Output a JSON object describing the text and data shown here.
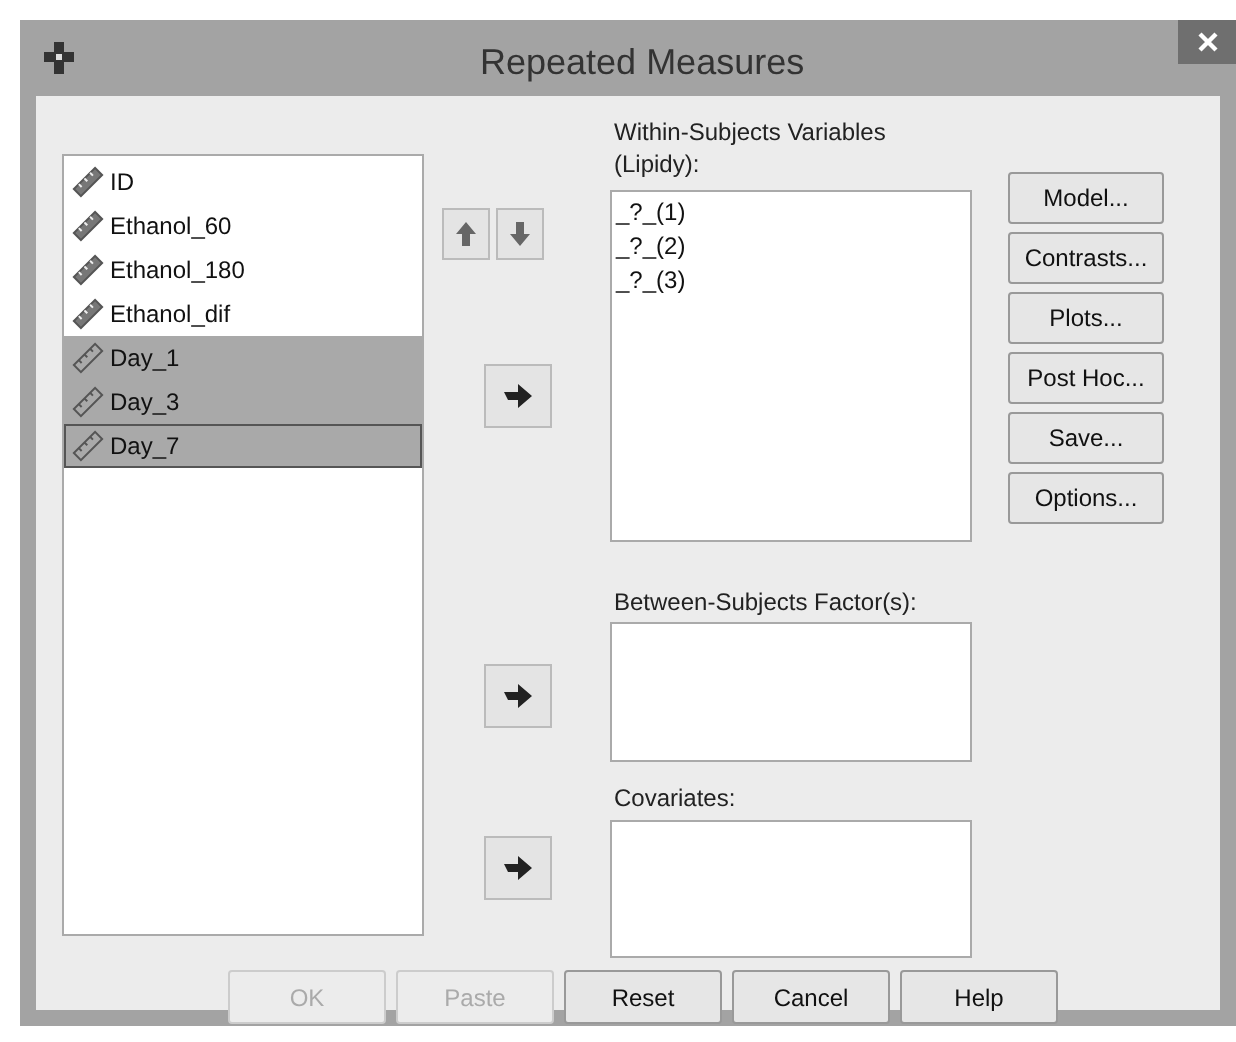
{
  "window": {
    "title": "Repeated Measures"
  },
  "variables": [
    {
      "name": "ID",
      "selected": false,
      "focused": false
    },
    {
      "name": "Ethanol_60",
      "selected": false,
      "focused": false
    },
    {
      "name": "Ethanol_180",
      "selected": false,
      "focused": false
    },
    {
      "name": "Ethanol_dif",
      "selected": false,
      "focused": false
    },
    {
      "name": "Day_1",
      "selected": true,
      "focused": false
    },
    {
      "name": "Day_3",
      "selected": true,
      "focused": false
    },
    {
      "name": "Day_7",
      "selected": true,
      "focused": true
    }
  ],
  "within_subjects": {
    "label": "Within-Subjects Variables (Lipidy):",
    "items": [
      "_?_(1)",
      "_?_(2)",
      "_?_(3)"
    ]
  },
  "between_subjects": {
    "label": "Between-Subjects Factor(s):"
  },
  "covariates": {
    "label": "Covariates:"
  },
  "side_buttons": [
    "Model...",
    "Contrasts...",
    "Plots...",
    "Post Hoc...",
    "Save...",
    "Options..."
  ],
  "bottom_buttons": [
    {
      "label": "OK",
      "disabled": true
    },
    {
      "label": "Paste",
      "disabled": true
    },
    {
      "label": "Reset",
      "disabled": false
    },
    {
      "label": "Cancel",
      "disabled": false
    },
    {
      "label": "Help",
      "disabled": false
    }
  ]
}
